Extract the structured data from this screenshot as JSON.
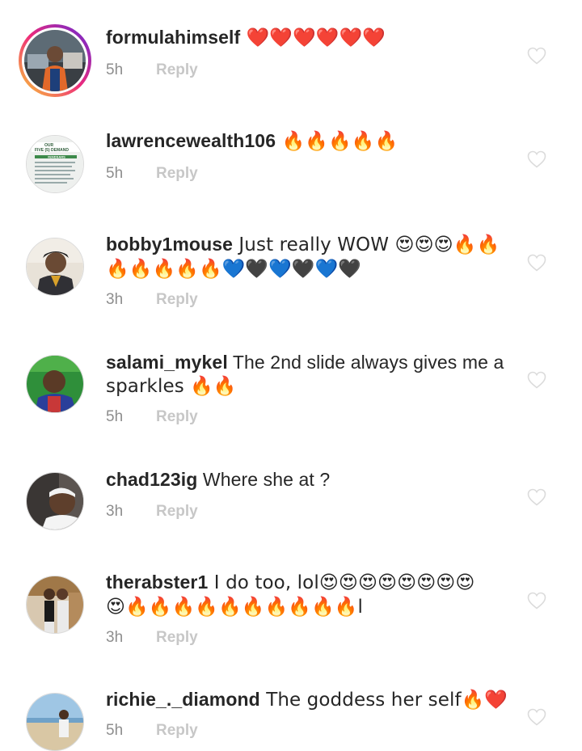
{
  "comments": [
    {
      "user": "formulahimself",
      "text": " ❤️❤️❤️❤️❤️❤️",
      "time": "5h",
      "reply": "Reply",
      "avatar": "avatar-formulahimself",
      "story_ring": true
    },
    {
      "user": "lawrencewealth106",
      "text": " 🔥🔥🔥🔥🔥",
      "time": "5h",
      "reply": "Reply",
      "avatar": "avatar-lawrencewealth106",
      "story_ring": false
    },
    {
      "user": "bobby1mouse",
      "text": " Just really WOW 😍😍😍🔥🔥",
      "text2": "🔥🔥🔥🔥🔥💙🖤💙🖤💙🖤",
      "time": "3h",
      "reply": "Reply",
      "avatar": "avatar-bobby1mouse",
      "story_ring": false
    },
    {
      "user": "salami_mykel",
      "text": " The 2nd slide always gives me a",
      "text2": "sparkles 🔥🔥",
      "time": "5h",
      "reply": "Reply",
      "avatar": "avatar-salami-mykel",
      "story_ring": false
    },
    {
      "user": "chad123ig",
      "text": " Where she at ?",
      "time": "3h",
      "reply": "Reply",
      "avatar": "avatar-chad123ig",
      "story_ring": false
    },
    {
      "user": "therabster1",
      "text": " I do too, lol😍😍😍😍😍😍😍😍",
      "text2": "😍🔥🔥🔥🔥🔥🔥🔥🔥🔥🔥l",
      "time": "3h",
      "reply": "Reply",
      "avatar": "avatar-therabster1",
      "story_ring": false
    },
    {
      "user": "richie_._diamond",
      "text": " The goddess her self🔥❤️",
      "time": "5h",
      "reply": "Reply",
      "avatar": "avatar-richie-diamond",
      "story_ring": false
    }
  ],
  "avatar_thumbnail_text": {
    "line1": "OUR",
    "line2": "FIVE (5) DEMAND",
    "line3": "#ENDSARS"
  },
  "colors": {
    "text": "#262626",
    "meta": "#8e8e8e",
    "reply": "#c7c7c7",
    "heart": "#dbdbdb",
    "ring_start": "#f9ce34",
    "ring_mid": "#ee2a7b",
    "ring_end": "#6228d7"
  }
}
